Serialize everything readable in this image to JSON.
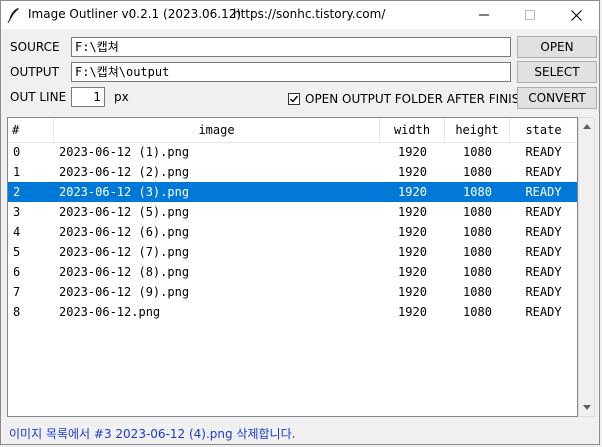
{
  "window": {
    "title": "Image Outliner v0.2.1 (2023.06.12)",
    "url": "https://sonhc.tistory.com/",
    "controls": {
      "minimize": "—",
      "maximize": "☐",
      "close": "✕"
    }
  },
  "form": {
    "source_label": "SOURCE",
    "source_value": "F:\\캡쳐",
    "output_label": "OUTPUT",
    "output_value": "F:\\캡쳐\\output",
    "outline_label": "OUT LINE",
    "outline_value": "1",
    "outline_unit": "px",
    "open_folder_label": "OPEN OUTPUT FOLDER AFTER FINISH",
    "open_folder_checked": true
  },
  "buttons": {
    "open": "OPEN",
    "select": "SELECT",
    "convert": "CONVERT"
  },
  "table": {
    "columns": [
      "#",
      "image",
      "width",
      "height",
      "state"
    ],
    "selected_index": 2,
    "rows": [
      {
        "num": "0",
        "image": "2023-06-12 (1).png",
        "width": "1920",
        "height": "1080",
        "state": "READY"
      },
      {
        "num": "1",
        "image": "2023-06-12 (2).png",
        "width": "1920",
        "height": "1080",
        "state": "READY"
      },
      {
        "num": "2",
        "image": "2023-06-12 (3).png",
        "width": "1920",
        "height": "1080",
        "state": "READY"
      },
      {
        "num": "3",
        "image": "2023-06-12 (5).png",
        "width": "1920",
        "height": "1080",
        "state": "READY"
      },
      {
        "num": "4",
        "image": "2023-06-12 (6).png",
        "width": "1920",
        "height": "1080",
        "state": "READY"
      },
      {
        "num": "5",
        "image": "2023-06-12 (7).png",
        "width": "1920",
        "height": "1080",
        "state": "READY"
      },
      {
        "num": "6",
        "image": "2023-06-12 (8).png",
        "width": "1920",
        "height": "1080",
        "state": "READY"
      },
      {
        "num": "7",
        "image": "2023-06-12 (9).png",
        "width": "1920",
        "height": "1080",
        "state": "READY"
      },
      {
        "num": "8",
        "image": "2023-06-12.png",
        "width": "1920",
        "height": "1080",
        "state": "READY"
      }
    ]
  },
  "status": {
    "message": "이미지 목록에서 #3 2023-06-12 (4).png 삭제합니다."
  },
  "colors": {
    "selection": "#0078d7",
    "status_text": "#1a3ccf"
  },
  "icons": {
    "app": "feather-quill-icon"
  }
}
